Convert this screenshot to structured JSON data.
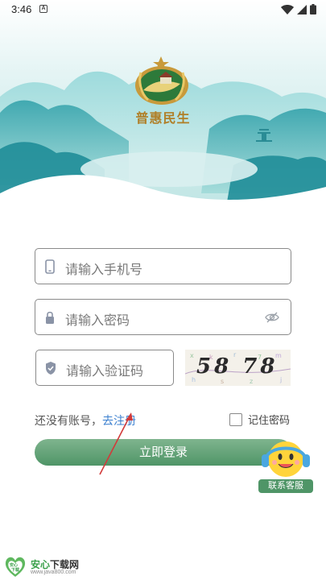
{
  "status_bar": {
    "time": "3:46",
    "notif_glyph": "A"
  },
  "header": {
    "brand_name": "普惠民生"
  },
  "form": {
    "phone_placeholder": "请输入手机号",
    "password_placeholder": "请输入密码",
    "captcha_placeholder": "请输入验证码",
    "captcha_text": "58 78"
  },
  "register": {
    "prompt": "还没有账号，",
    "link": "去注册"
  },
  "remember": {
    "label": "记住密码",
    "checked": false
  },
  "login_button": "立即登录",
  "customer_service": {
    "label": "联系客服"
  },
  "watermark": {
    "title_a": "安心",
    "title_b": "下载网",
    "url": "www.java800.com",
    "logo_text_top": "安心",
    "logo_text_bottom": "下载"
  },
  "colors": {
    "accent_green": "#4f9567",
    "link_blue": "#3a7fcf",
    "brand_gold": "#b07f28"
  }
}
